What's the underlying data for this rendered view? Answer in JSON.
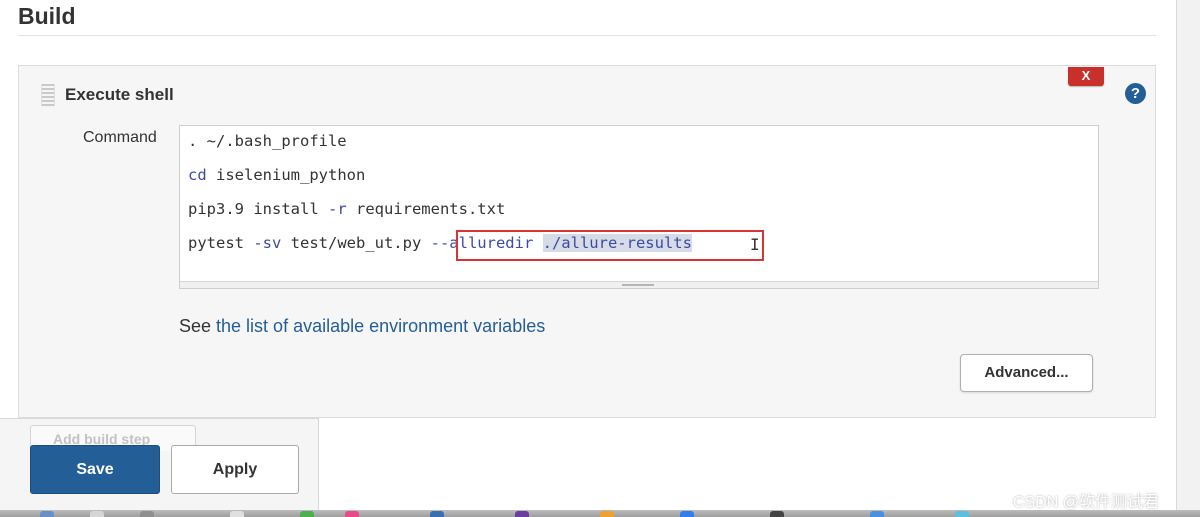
{
  "section": {
    "title": "Build"
  },
  "build_step": {
    "title": "Execute shell",
    "delete_label": "X",
    "help_label": "?",
    "command_label": "Command",
    "command_lines": {
      "line1": {
        "text": ". ~/.bash_profile"
      },
      "line2": {
        "kw": "cd",
        "rest": " iselenium_python"
      },
      "line3": {
        "pre": "pip3.9 install ",
        "kw": "-r",
        "post": " requirements.txt"
      },
      "line4": {
        "pre": "pytest ",
        "kw": "-sv",
        "mid": " test/web_ut.py ",
        "opt": "--alluredir",
        "space": " ",
        "path": "./allure-results"
      }
    },
    "env_prefix": "See ",
    "env_link": "the list of available environment variables",
    "advanced_label": "Advanced..."
  },
  "footer": {
    "add_step_label": "Add build step",
    "save_label": "Save",
    "apply_label": "Apply"
  },
  "watermark": "CSDN @软件测试君",
  "colors": {
    "primary": "#245e96",
    "danger": "#c9302c",
    "highlight_border": "#d93434",
    "keyword": "#3b4aa8"
  }
}
